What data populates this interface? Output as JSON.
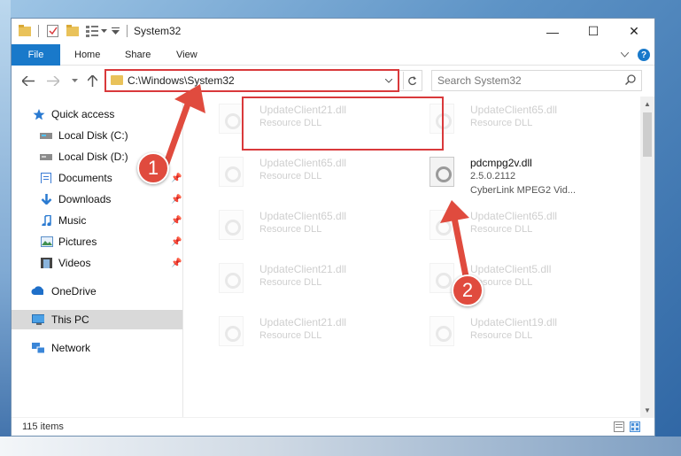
{
  "window": {
    "title": "System32",
    "controls": {
      "minimize": "—",
      "maximize": "☐",
      "close": "✕"
    }
  },
  "ribbon": {
    "file_tab": "File",
    "tabs": [
      "Home",
      "Share",
      "View"
    ]
  },
  "address": {
    "path": "C:\\Windows\\System32",
    "search_placeholder": "Search System32"
  },
  "sidebar": {
    "items": [
      {
        "label": "Quick access",
        "icon": "star-icon"
      },
      {
        "label": "Local Disk (C:)",
        "icon": "drive-icon"
      },
      {
        "label": "Local Disk (D:)",
        "icon": "drive-icon"
      },
      {
        "label": "Documents",
        "icon": "documents-icon"
      },
      {
        "label": "Downloads",
        "icon": "download-icon"
      },
      {
        "label": "Music",
        "icon": "music-icon"
      },
      {
        "label": "Pictures",
        "icon": "pictures-icon"
      },
      {
        "label": "Videos",
        "icon": "videos-icon"
      },
      {
        "label": "OneDrive",
        "icon": "cloud-icon"
      },
      {
        "label": "This PC",
        "icon": "computer-icon"
      },
      {
        "label": "Network",
        "icon": "network-icon"
      }
    ]
  },
  "files": [
    {
      "name": "UpdateClient21.dll",
      "desc": "Resource DLL"
    },
    {
      "name": "UpdateClient65.dll",
      "desc": "Resource DLL"
    },
    {
      "name": "UpdateClient65.dll",
      "desc": "Resource DLL"
    },
    {
      "name": "pdcmpg2v.dll",
      "version": "2.5.0.2112",
      "desc": "CyberLink MPEG2 Vid..."
    },
    {
      "name": "UpdateClient65.dll",
      "desc": "Resource DLL"
    },
    {
      "name": "UpdateClient65.dll",
      "desc": "Resource DLL"
    },
    {
      "name": "UpdateClient21.dll",
      "desc": "Resource DLL"
    },
    {
      "name": "UpdateClient5.dll",
      "desc": "Resource DLL"
    },
    {
      "name": "UpdateClient21.dll",
      "desc": "Resource DLL"
    },
    {
      "name": "UpdateClient19.dll",
      "desc": "Resource DLL"
    }
  ],
  "status": {
    "items_count": "115 items"
  },
  "annotations": {
    "step1": "1",
    "step2": "2"
  },
  "colors": {
    "accent": "#1979ca",
    "highlight": "#d9393b",
    "annotation": "#e04b3e"
  }
}
